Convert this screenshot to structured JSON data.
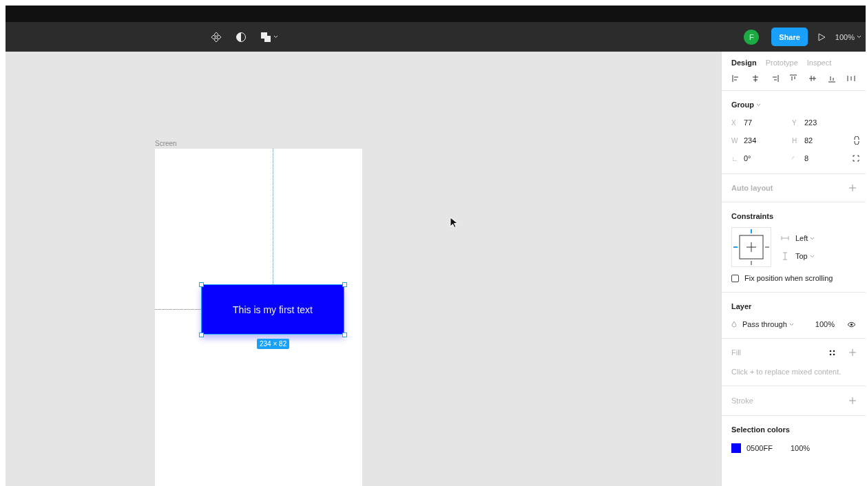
{
  "toolbar": {
    "avatar": "F",
    "share": "Share",
    "zoom": "100%"
  },
  "canvas": {
    "frame_label": "Screen",
    "element": {
      "text": "This is my first text",
      "color": "#0500ff"
    },
    "size_badge": "234 × 82"
  },
  "panel": {
    "tabs": [
      {
        "label": "Design",
        "selected": true
      },
      {
        "label": "Prototype",
        "selected": false
      },
      {
        "label": "Inspect",
        "selected": false
      }
    ],
    "group": {
      "title": "Group",
      "fields": [
        {
          "label": "X",
          "value": "77"
        },
        {
          "label": "Y",
          "value": "223"
        },
        {
          "label": "W",
          "value": "234"
        },
        {
          "label": "H",
          "value": "82"
        },
        {
          "label": "∟",
          "value": "0°"
        },
        {
          "label": "◜",
          "value": "8"
        }
      ]
    },
    "auto_layout": "Auto layout",
    "constraints": {
      "title": "Constraints",
      "horizontal": "Left",
      "vertical": "Top",
      "fix_position": {
        "label": "Fix position when scrolling",
        "checked": false
      }
    },
    "layer": {
      "title": "Layer",
      "blend": "Pass through",
      "opacity": "100%"
    },
    "fill": {
      "title": "Fill",
      "hint": "Click + to replace mixed content."
    },
    "stroke": "Stroke",
    "selection_colors": {
      "title": "Selection colors",
      "items": [
        {
          "hex": "0500FF",
          "opacity": "100%",
          "color": "#0500ff"
        }
      ]
    }
  }
}
